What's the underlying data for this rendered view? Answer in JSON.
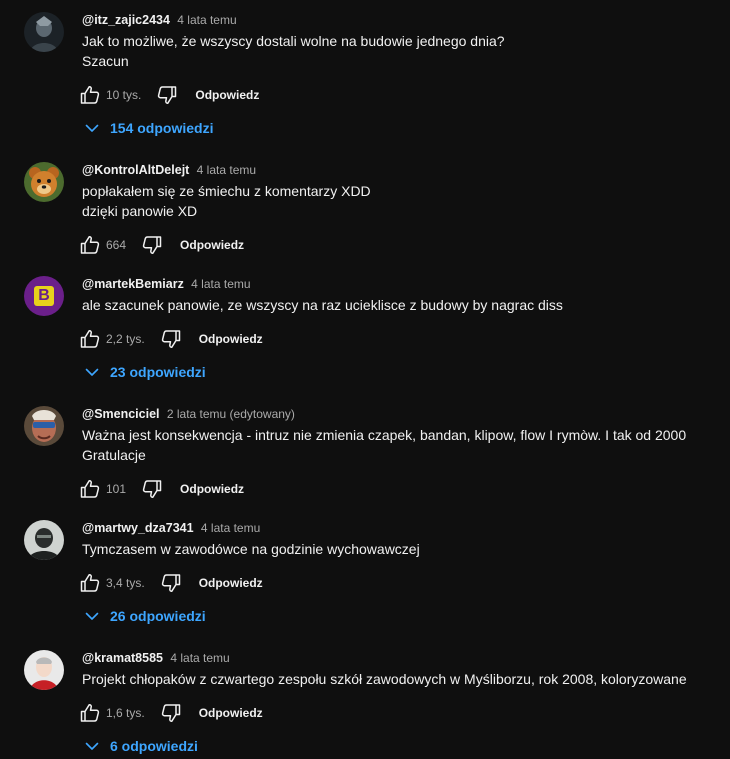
{
  "ui": {
    "reply_label": "Odpowiedz",
    "accent_color": "#3ea6ff"
  },
  "comments": [
    {
      "author": "@itz_zajic2434",
      "time": "4 lata temu",
      "text": "Jak to możliwe, że wszyscy dostali wolne na budowie jednego dnia?\nSzacun",
      "likes": "10 tys.",
      "replies": "154 odpowiedzi",
      "avatar": "dark-figure-avatar"
    },
    {
      "author": "@KontrolAltDelejt",
      "time": "4 lata temu",
      "text": "popłakałem się ze śmiechu z komentarzy XDD\ndzięki panowie XD",
      "likes": "664",
      "replies": "",
      "avatar": "cartoon-bear-avatar"
    },
    {
      "author": "@martekBemiarz",
      "time": "4 lata temu",
      "text": "ale szacunek panowie, ze wszyscy na raz ucieklisce z budowy by nagrac diss",
      "likes": "2,2 tys.",
      "replies": "23 odpowiedzi",
      "avatar": "letter-b-avatar",
      "avatar_letter": "B"
    },
    {
      "author": "@Smenciciel",
      "time": "2 lata temu (edytowany)",
      "text": "Ważna jest konsekwencja - intruz nie zmienia czapek, bandan, klipow, flow I rymòw. I tak od 2000\nGratulacje",
      "likes": "101",
      "replies": "",
      "avatar": "face-photo-avatar"
    },
    {
      "author": "@martwy_dza7341",
      "time": "4 lata temu",
      "text": "Tymczasem w zawodówce na godzinie wychowawczej",
      "likes": "3,4 tys.",
      "replies": "26 odpowiedzi",
      "avatar": "masked-figure-avatar"
    },
    {
      "author": "@kramat8585",
      "time": "4 lata temu",
      "text": "Projekt chłopaków z czwartego zespołu szkół zawodowych w Myśliborzu, rok 2008, koloryzowane",
      "likes": "1,6 tys.",
      "replies": "6 odpowiedzi",
      "avatar": "red-figure-avatar"
    }
  ]
}
